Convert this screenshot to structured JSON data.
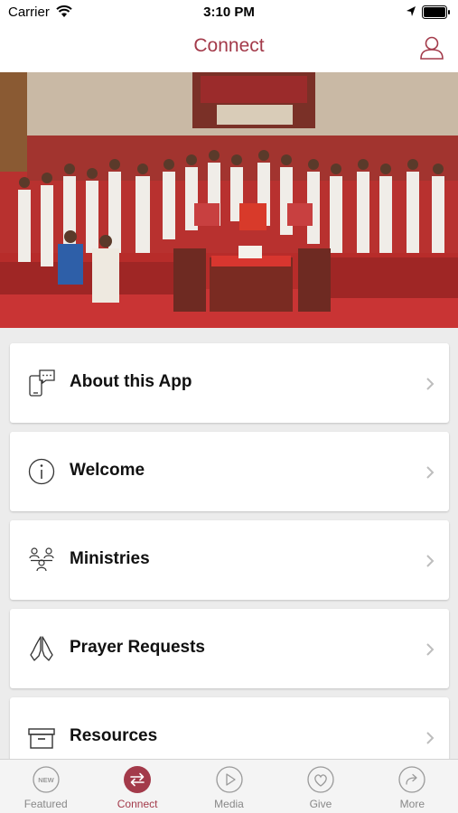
{
  "status_bar": {
    "carrier": "Carrier",
    "time": "3:10 PM"
  },
  "nav": {
    "title": "Connect",
    "profile_icon": "person-icon"
  },
  "hero": {
    "description_icon": "congregation-photo"
  },
  "menu": {
    "items": [
      {
        "label": "About this App",
        "icon": "phone-chat-icon"
      },
      {
        "label": "Welcome",
        "icon": "info-icon"
      },
      {
        "label": "Ministries",
        "icon": "people-group-icon"
      },
      {
        "label": "Prayer Requests",
        "icon": "praying-hands-icon"
      },
      {
        "label": "Resources",
        "icon": "archive-box-icon"
      }
    ]
  },
  "tabs": [
    {
      "label": "Featured",
      "icon": "new-badge-icon",
      "active": false
    },
    {
      "label": "Connect",
      "icon": "exchange-arrows-icon",
      "active": true
    },
    {
      "label": "Media",
      "icon": "play-icon",
      "active": false
    },
    {
      "label": "Give",
      "icon": "heart-icon",
      "active": false
    },
    {
      "label": "More",
      "icon": "share-arrow-icon",
      "active": false
    }
  ],
  "colors": {
    "accent": "#a33a4a",
    "tab_inactive": "#888888",
    "background": "#ececec"
  }
}
